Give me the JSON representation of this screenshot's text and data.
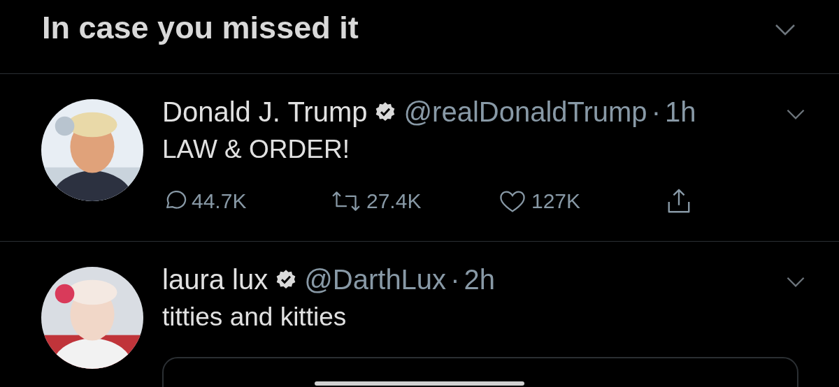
{
  "header": {
    "title": "In case you missed it"
  },
  "tweets": [
    {
      "name": "Donald J. Trump",
      "verified": true,
      "handle": "@realDonaldTrump",
      "separator": "·",
      "time": "1h",
      "text": "LAW & ORDER!",
      "stats": {
        "replies": "44.7K",
        "retweets": "27.4K",
        "likes": "127K"
      },
      "quoted": false
    },
    {
      "name": "laura lux",
      "verified": true,
      "handle": "@DarthLux",
      "separator": "·",
      "time": "2h",
      "text": "titties and kitties",
      "quoted": true
    }
  ]
}
